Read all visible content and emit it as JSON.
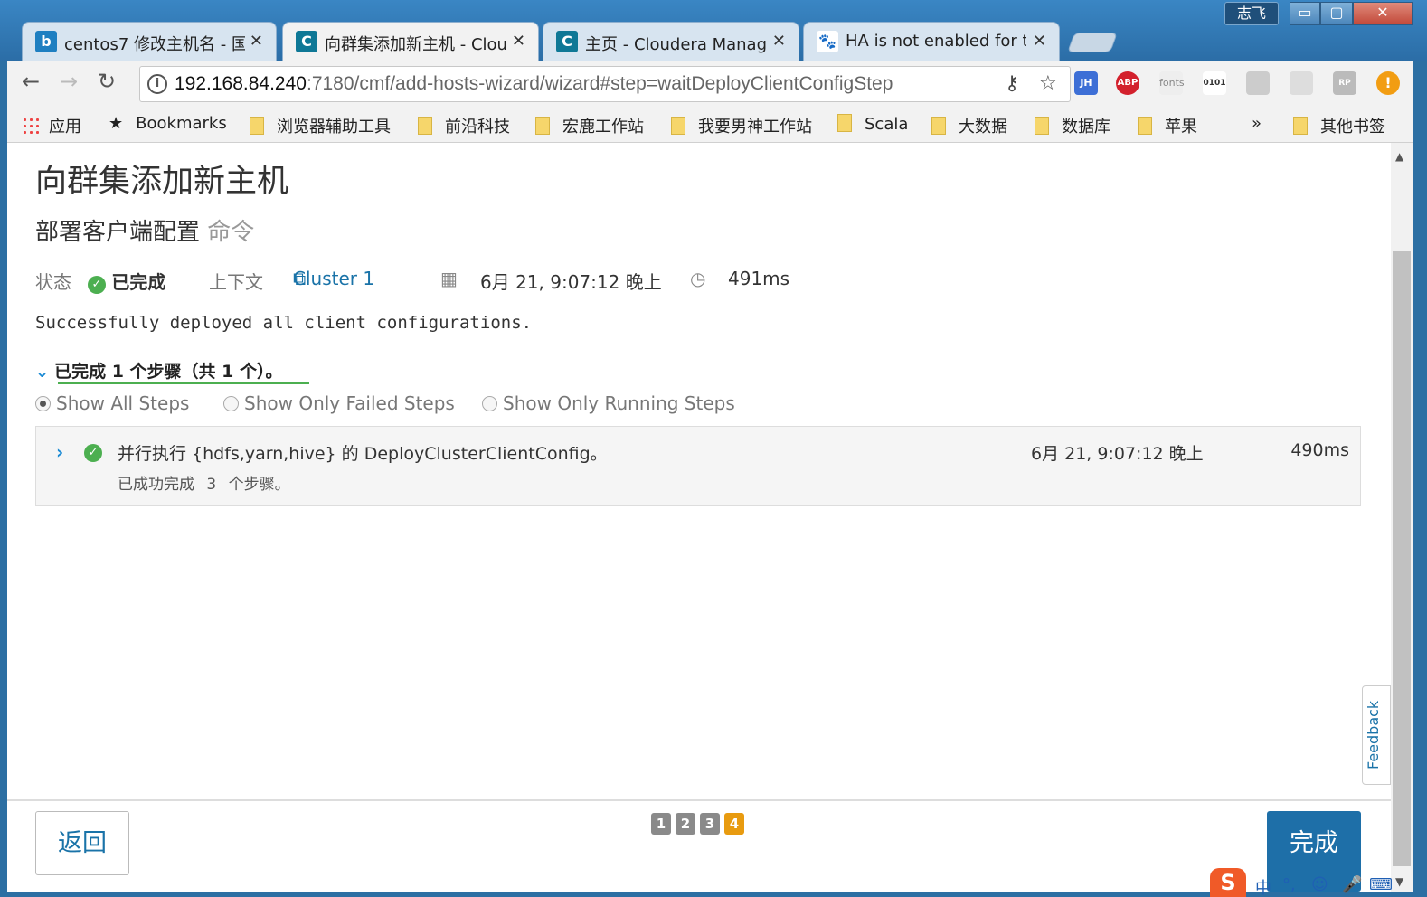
{
  "window": {
    "user_badge": "志飞",
    "minimize": "▭",
    "maximize": "▢",
    "close": "✕"
  },
  "tabs": [
    {
      "title": "centos7 修改主机名 - 国",
      "favicon": "b",
      "favicon_color": "#1e7fc1"
    },
    {
      "title": "向群集添加新主机 - Clou",
      "favicon": "C",
      "favicon_color": "#0f7896"
    },
    {
      "title": "主页 - Cloudera Manag",
      "favicon": "C",
      "favicon_color": "#0f7896"
    },
    {
      "title": "HA is not enabled for th",
      "favicon": "🐾",
      "favicon_color": "#2f6fe0"
    }
  ],
  "toolbar": {
    "url_host": "192.168.84.240",
    "url_rest": ":7180/cmf/add-hosts-wizard/wizard#step=waitDeployClientConfigStep",
    "extensions": [
      "JH",
      "ABP",
      "fonts",
      "0101",
      "ext5",
      "ext6",
      "RP",
      "!"
    ]
  },
  "bookmarks": {
    "apps": "应用",
    "items": [
      "Bookmarks",
      "浏览器辅助工具",
      "前沿科技",
      "宏鹿工作站",
      "我要男神工作站",
      "Scala",
      "大数据",
      "数据库",
      "苹果"
    ],
    "overflow": "»",
    "other": "其他书签"
  },
  "page": {
    "title": "向群集添加新主机",
    "subtitle_main": "部署客户端配置",
    "subtitle_muted": "命令",
    "status_label": "状态",
    "status_value": "已完成",
    "context_label": "上下文",
    "context_link": "Cluster 1",
    "timestamp": "6月 21, 9:07:12 晚上",
    "duration": "491ms",
    "message": "Successfully deployed all client configurations.",
    "steps_summary": "已完成 1 个步骤（共 1 个）。",
    "filters": [
      "Show All Steps",
      "Show Only Failed Steps",
      "Show Only Running Steps"
    ],
    "step": {
      "title": "并行执行 {hdfs,yarn,hive} 的 DeployClusterClientConfig。",
      "sub_prefix": "已成功完成",
      "sub_count": "3",
      "sub_suffix": "个步骤。",
      "time": "6月 21, 9:07:12 晚上",
      "duration": "490ms"
    },
    "feedback": "Feedback",
    "back_button": "返回",
    "finish_button": "完成",
    "pager": [
      "1",
      "2",
      "3",
      "4"
    ],
    "current_page": "4"
  },
  "ime": {
    "logo": "S",
    "mode": "中"
  }
}
